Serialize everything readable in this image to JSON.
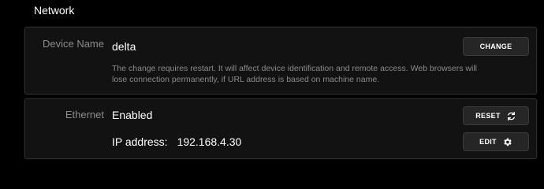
{
  "section": {
    "title": "Network"
  },
  "device": {
    "label": "Device Name",
    "value": "delta",
    "hint": "The change requires restart. It will affect device identification and remote access. Web browsers will lose connection permanently, if URL address is based on machine name.",
    "change_label": "CHANGE"
  },
  "ethernet": {
    "label": "Ethernet",
    "status": "Enabled",
    "ip_label": "IP address:",
    "ip_value": "192.168.4.30",
    "reset_label": "RESET",
    "reset_icon": "refresh-icon",
    "edit_label": "EDIT",
    "edit_icon": "gear-icon"
  },
  "colors": {
    "background": "#000000",
    "panel": "#121212",
    "button": "#262626",
    "muted_text": "#8c8c8c"
  }
}
